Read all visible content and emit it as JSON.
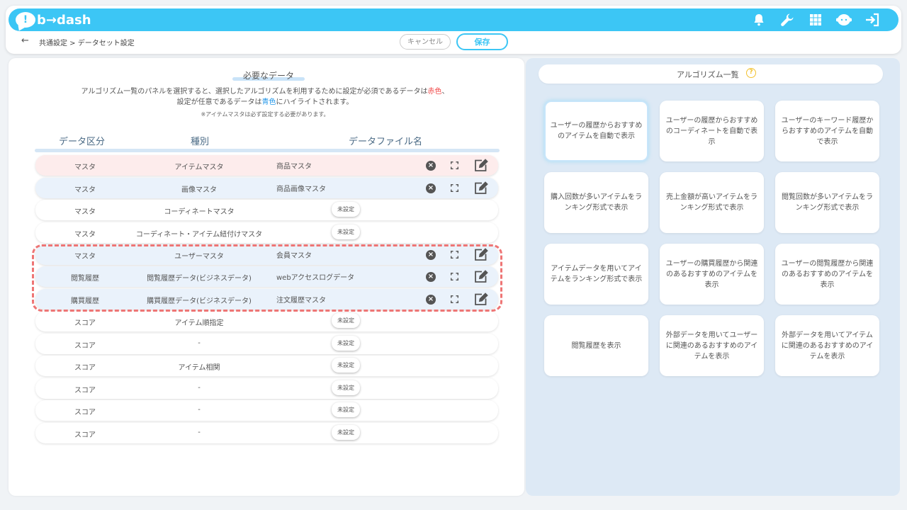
{
  "app": {
    "logo_mark": "!",
    "logo_text": "b→dash"
  },
  "header_icons": [
    "bell-icon",
    "wrench-icon",
    "grid-icon",
    "user-face-icon",
    "logout-icon"
  ],
  "breadcrumb": {
    "back": "←",
    "text": "共通設定 > データセット設定"
  },
  "actions": {
    "cancel": "キャンセル",
    "save": "保存"
  },
  "required": {
    "title": "必要なデータ",
    "desc1_pre": "アルゴリズム一覧のパネルを選択すると、選択したアルゴリズムを利用するために設定が必須であるデータは",
    "desc1_red": "赤色",
    "desc1_post": "、",
    "desc2_pre": "設定が任意であるデータは",
    "desc2_blue": "青色",
    "desc2_post": "にハイライトされます。",
    "note": "※アイテムマスタは必ず設定する必要があります。"
  },
  "table": {
    "headers": {
      "kubun": "データ区分",
      "shubetsu": "種別",
      "file": "データファイル名"
    },
    "unset_label": "未設定",
    "rows": [
      {
        "kubun": "マスタ",
        "shubetsu": "アイテムマスタ",
        "file": "商品マスタ",
        "state": "red"
      },
      {
        "kubun": "マスタ",
        "shubetsu": "画像マスタ",
        "file": "商品画像マスタ",
        "state": "blue"
      },
      {
        "kubun": "マスタ",
        "shubetsu": "コーディネートマスタ",
        "file": "",
        "state": "unset"
      },
      {
        "kubun": "マスタ",
        "shubetsu": "コーディネート・アイテム紐付けマスタ",
        "file": "",
        "state": "unset"
      },
      {
        "kubun": "マスタ",
        "shubetsu": "ユーザーマスタ",
        "file": "会員マスタ",
        "state": "blue"
      },
      {
        "kubun": "閲覧履歴",
        "shubetsu": "閲覧履歴データ(ビジネスデータ)",
        "file": "webアクセスログデータ",
        "state": "blue"
      },
      {
        "kubun": "購買履歴",
        "shubetsu": "購買履歴データ(ビジネスデータ)",
        "file": "注文履歴マスタ",
        "state": "blue"
      },
      {
        "kubun": "スコア",
        "shubetsu": "アイテム順指定",
        "file": "",
        "state": "unset"
      },
      {
        "kubun": "スコア",
        "shubetsu": "-",
        "file": "",
        "state": "unset"
      },
      {
        "kubun": "スコア",
        "shubetsu": "アイテム相関",
        "file": "",
        "state": "unset"
      },
      {
        "kubun": "スコア",
        "shubetsu": "-",
        "file": "",
        "state": "unset"
      },
      {
        "kubun": "スコア",
        "shubetsu": "-",
        "file": "",
        "state": "unset"
      },
      {
        "kubun": "スコア",
        "shubetsu": "-",
        "file": "",
        "state": "unset"
      }
    ]
  },
  "algorithms": {
    "title": "アルゴリズム一覧",
    "help": "?",
    "cards": [
      "ユーザーの履歴からおすすめのアイテムを自動で表示",
      "ユーザーの履歴からおすすめのコーディネートを自動で表示",
      "ユーザーのキーワード履歴からおすすめのアイテムを自動で表示",
      "購入回数が多いアイテムをランキング形式で表示",
      "売上金額が高いアイテムをランキング形式で表示",
      "閲覧回数が多いアイテムをランキング形式で表示",
      "アイテムデータを用いてアイテムをランキング形式で表示",
      "ユーザーの購買履歴から関連のあるおすすめのアイテムを表示",
      "ユーザーの閲覧履歴から関連のあるおすすめのアイテムを表示",
      "閲覧履歴を表示",
      "外部データを用いてユーザーに関連のあるおすすめのアイテムを表示",
      "外部データを用いてアイテムに関連のあるおすすめのアイテムを表示"
    ],
    "selected_index": 0
  },
  "colors": {
    "accent": "#3cc6f5",
    "required_red": "#f04848",
    "optional_blue": "#2196e8",
    "highlight_dash": "#ee7575"
  }
}
